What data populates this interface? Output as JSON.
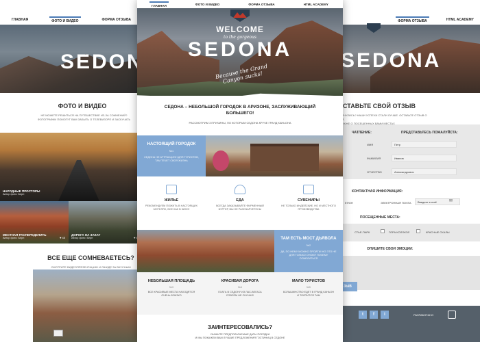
{
  "left": {
    "nav": [
      "ГЛАВНАЯ",
      "ФОТО И ВИДЕО",
      "ФОРМА ОТЗЫВА"
    ],
    "hero_title": "SEDONA",
    "section_title": "ФОТО И ВИДЕО",
    "section_text": [
      "НЕ МОЖЕТЕ РЕШИТЬСЯ НА ПУТЕШЕСТВИЕ ИЗ-ЗА СОМНЕНИЙ?",
      "ФОТОГРАФИИ ПОМОГУТ ВАМ ЗАБЫТЬ О ТЕЛЕВИЗОРЕ И ЗАСКУЧАТЬ"
    ],
    "photo1": {
      "title": "НАРОДНЫЕ ПРОСТОРЫ",
      "author": "Автор фото: Берн"
    },
    "photo2": {
      "title": "МЕСТНАЯ РАСПЕРЕДЕЛИТЬ",
      "author": "Автор фото: Берн",
      "likes": "♥ 45"
    },
    "photo3": {
      "title": "ДОРОГА НА ЗАКАТ",
      "author": "Автор фото: Берн",
      "likes": "♥ 45"
    },
    "doubt_title": "ВСЕ ЕЩЕ СОМНЕВАЕТЕСЬ?",
    "doubt_text": [
      "СМОТРИТЕ ВИДЕОПРЕЗЕНТАЦИЮ И ОЖИДЕ ЗА ВКУСНЫМ",
      "ОЧЕНЬ ПОДРОБНЫМ В ЕЖЕНЕДЕЛЬНОМ"
    ]
  },
  "center": {
    "nav": [
      "ГЛАВНАЯ",
      "ФОТО И ВИДЕО",
      "ФОРМА ОТЗЫВА",
      "HTML ACADEMY"
    ],
    "welcome": "WELCOME",
    "to_the_gorgeous": "to the gorgeous",
    "hero_title": "SEDONA",
    "tagline": "Because the Grand Canyon sucks!",
    "intro_title": "СЕДОНА – НЕБОЛЬШОЙ ГОРОДОК В АРИЗОНЕ, ЗАСЛУЖИВАЮЩИЙ БОЛЬШЕГО!",
    "intro_sub": "РАССМОТРИМ 3 ПРИЧИНЫ, ПО КОТОРЫМ СЕДОНА КРУЧЕ ГРАНД КАНЬОНА",
    "town_box": {
      "title": "НАСТОЯЩИЙ ГОРОДОК",
      "num": "№1",
      "text": "СЕДОНА НЕ АТТРАКЦИОН ДЛЯ ТУРИСТОВ, ТАМ ТЕЧЕТ СВОЯ ЖИЗНЬ"
    },
    "features": [
      {
        "title": "ЖИЛЬЕ",
        "text": "РЕКОМЕНДУЕМ ПОЖИТЬ В НАСТОЯЩИХ МОТЕЛЯХ, ВСЕ КАК В КИНО!",
        "icon": "house-icon"
      },
      {
        "title": "ЕДА",
        "text": "ВСЕГДА ЗАКАЗЫВАЙТЕ ФИРМЕННЫЙ БУРГЕР, ВЫ НЕ РАЗОЧАРУЕТЕСЬ!",
        "icon": "burger-icon"
      },
      {
        "title": "СУВЕНИРЫ",
        "text": "НЕ ТОЛЬКО ИНДЕЙСКИЕ, НО И МЕСТНОГО ПРОИЗВОДСТВА",
        "icon": "gift-icon"
      }
    ],
    "bridge_box": {
      "title": "ТАМ ЕСТЬ МОСТ ДЬЯВОЛА",
      "num": "№2",
      "text": "ДА, ПО НЕМУ МОЖНО ПРОЙТИ! НО ЭТО НЕ ДЛЯ ТОЛЬКО ОНОМУ ПОЧЕМУ ОСМЕЛИТЬСЯ"
    },
    "stats": [
      {
        "title": "НЕБОЛЬШАЯ ПЛОЩАДЬ",
        "num": "№3",
        "text": "ВСЕ КРАСИВЫЕ МЕСТА НАХОДЯТСЯ ОЧЕНЬ БЛИЗКО"
      },
      {
        "title": "КРАСИВАЯ ДОРОГА",
        "num": "№4",
        "text": "ЕХАТЬ В СЕДОНУ ИЗ ЛАС-ВЕГАСА СОВСЕМ НЕ СКУЧНО!"
      },
      {
        "title": "МАЛО ТУРИСТОВ",
        "num": "№5",
        "text": "БОЛЬШИНСТВО ЕДЕТ В ГРАНД КАНЬОН И ТОЛПИТСЯ ТАМ"
      }
    ],
    "interested_title": "ЗАИНТЕРЕСОВАЛИСЬ?",
    "interested_text": [
      "УКАЖИТЕ ПРЕДПОЛАГАЕМЫЕ ДАТЫ ПОЕЗДКИ",
      "И МЫ ПОКАЖЕМ ВАМ ЛУЧШИЕ ПРЕДЛОЖЕНИЯ ГОСТИНИЦ В СЕДОНЕ"
    ]
  },
  "right": {
    "nav": [
      "ФОРМА ОТЗЫВА",
      "HTML ACADEMY"
    ],
    "hero_title": "SEDONA",
    "section_title": "ОСТАВЬТЕ СВОЙ ОТЗЫВ",
    "section_text": [
      "ВЕРНУЛИСЬ? НАШИ УСПЕХИ СТАЛИ ЛУЧШЕ. ОСТАВЬТЕ ОТЗЫВ О НЕЙ,",
      "А ТАКЖЕ О ПОСЕЩЕННЫХ ВАМИ МЕСТАХ"
    ],
    "impression": "ЧАТЛЕНИЕ:",
    "introduce": "ПРЕДСТАВЬТЕСЬ ПОЖАЛУЙСТА:",
    "fields": [
      {
        "label": "ИМЯ",
        "value": "Петр"
      },
      {
        "label": "ФАМИЛИЯ",
        "value": "Иванов"
      },
      {
        "label": "ОТЧЕСТВО",
        "value": "Александрович"
      }
    ],
    "contact_title": "КОНТАКТНАЯ ИНФОРМАЦИЯ:",
    "phone_label": "ЕФОН",
    "email_label": "ЭЛЕКТРОННАЯ ПОЧТА",
    "email_value": "Введите e-mail",
    "visited_title": "ПОСЕЩЕННЫЕ МЕСТА:",
    "places": [
      "СТЬЕ-ПАРК",
      "ГОРА КОЛОКОЛ",
      "КРАСНЫЕ СКАЛЫ"
    ],
    "emotions_title": "ОПИШИТЕ СВОИ ЭМОЦИИ:",
    "submit": "ЗЫВ",
    "social": [
      "t",
      "f",
      "i"
    ],
    "developer": "РАЗРАБОТАНО"
  }
}
